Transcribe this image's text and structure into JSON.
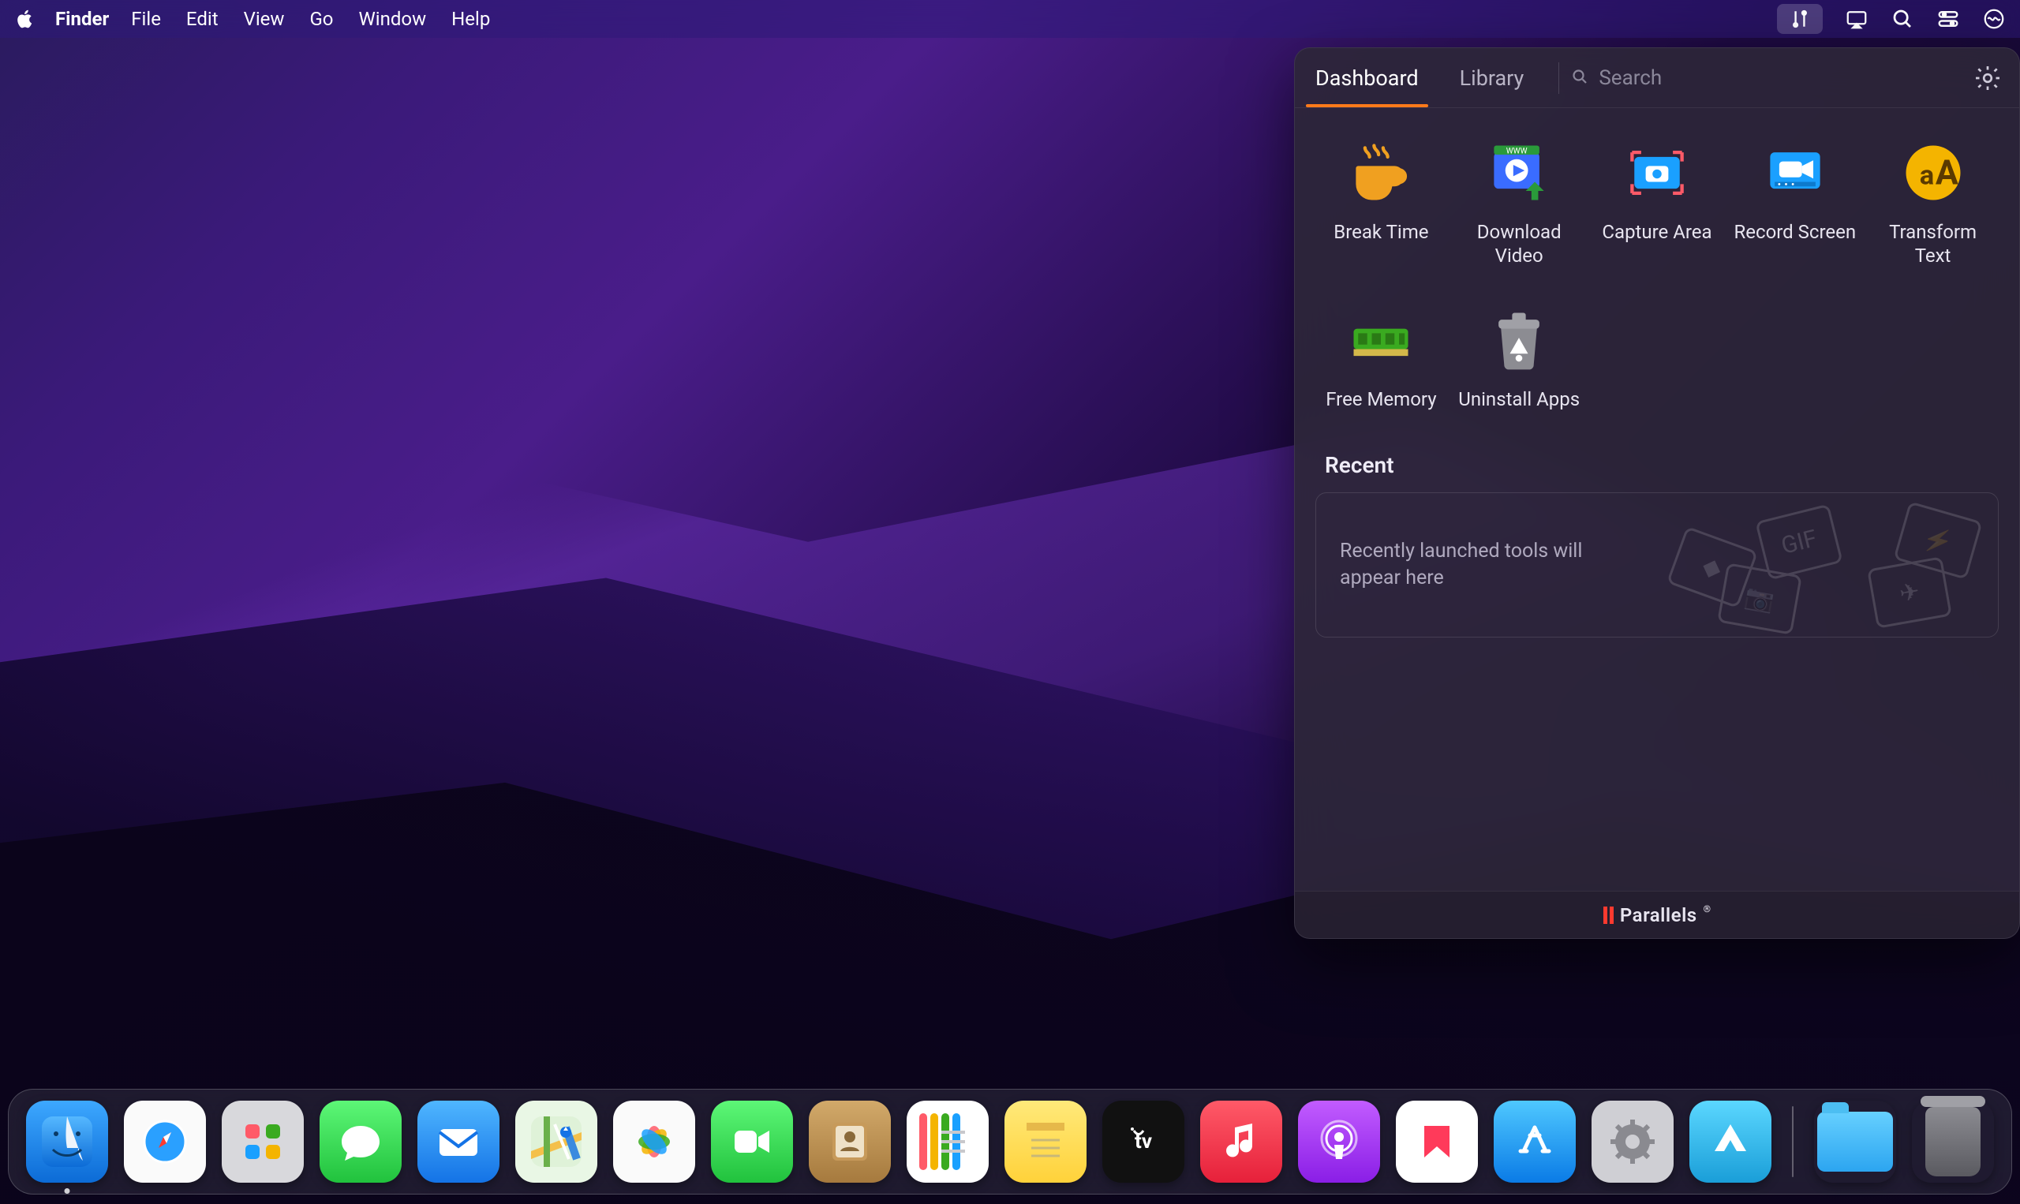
{
  "menubar": {
    "app_name": "Finder",
    "items": [
      "File",
      "Edit",
      "View",
      "Go",
      "Window",
      "Help"
    ]
  },
  "panel": {
    "tabs": {
      "dashboard": "Dashboard",
      "library": "Library"
    },
    "search_placeholder": "Search",
    "tools": [
      {
        "id": "break-time",
        "label": "Break Time"
      },
      {
        "id": "download-video",
        "label": "Download Video"
      },
      {
        "id": "capture-area",
        "label": "Capture Area"
      },
      {
        "id": "record-screen",
        "label": "Record Screen"
      },
      {
        "id": "transform-text",
        "label": "Transform Text"
      },
      {
        "id": "free-memory",
        "label": "Free Memory"
      },
      {
        "id": "uninstall-apps",
        "label": "Uninstall Apps"
      }
    ],
    "recent_title": "Recent",
    "recent_empty": "Recently launched tools will appear here",
    "brand": "Parallels"
  },
  "dock": {
    "apps": [
      "Finder",
      "Safari",
      "Launchpad",
      "Messages",
      "Mail",
      "Maps",
      "Photos",
      "FaceTime",
      "Contacts",
      "Reminders",
      "Notes",
      "TV",
      "Music",
      "Podcasts",
      "News",
      "App Store",
      "System Preferences",
      "NordPass"
    ],
    "right": [
      "Downloads",
      "Trash"
    ]
  }
}
